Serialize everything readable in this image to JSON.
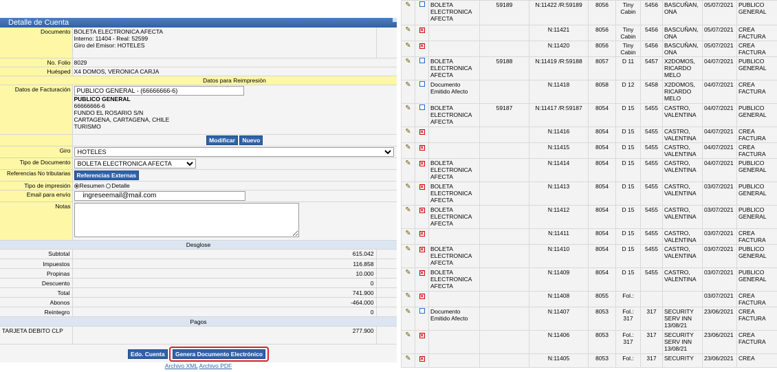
{
  "panel_title": "Detalle de Cuenta",
  "form": {
    "documento_label": "Documento",
    "documento_lines": [
      "BOLETA ELECTRONICA AFECTA",
      "Interno: 11404 - Real: 52599",
      "Giro del Emisor: HOTELES"
    ],
    "folio_label": "No. Folio",
    "folio_value": "8029",
    "huesped_label": "Huésped",
    "huesped_value": "X4 DOMOS, VERONICA CARJA",
    "reimpresion_header": "Datos para Reimpresión",
    "facturacion_label": "Datos de Facturación",
    "facturacion_input": "PUBLICO GENERAL - (66666666-6)",
    "facturacion_name": "PUBLICO GENERAL",
    "facturacion_lines": [
      "66666666-6",
      "FUNDO EL ROSARIO S/N",
      "CARTAGENA, CARTAGENA, CHILE",
      "TURISMO"
    ],
    "modificar_btn": "Modificar",
    "nuevo_btn": "Nuevo",
    "giro_label": "Giro",
    "giro_value": "HOTELES",
    "tipo_doc_label": "Tipo de Documento",
    "tipo_doc_value": "BOLETA ELECTRONICA AFECTA",
    "referencias_label": "Referencias No tributarias",
    "referencias_btn": "Referencias Externas",
    "tipo_impresion_label": "Tipo de impresión",
    "resumen_label": "Resumen",
    "detalle_label": "Detalle",
    "email_label": "Email para envío",
    "email_value": "ingreseemail@mail.com",
    "notas_label": "Notas"
  },
  "desglose": {
    "header": "Desglose",
    "rows": [
      {
        "label": "Subtotal",
        "value": "615.042"
      },
      {
        "label": "Impuestos",
        "value": "116.858"
      },
      {
        "label": "Propinas",
        "value": "10.000"
      },
      {
        "label": "Descuento",
        "value": "0"
      },
      {
        "label": "Total",
        "value": "741.900"
      },
      {
        "label": "Abonos",
        "value": "-464.000"
      },
      {
        "label": "Reintegro",
        "value": "0"
      }
    ]
  },
  "pagos": {
    "header": "Pagos",
    "method": "TARJETA DEBITO CLP",
    "amount": "277.900"
  },
  "actions": {
    "edo_cuenta": "Edo. Cuenta",
    "genera_doc": "Genera Documento Electrónico",
    "archivo_xml": "Archivo XML",
    "archivo_pdf": "Archivo PDF"
  },
  "grid_rows": [
    {
      "status": "square",
      "doc": "BOLETA ELECTRONICA AFECTA",
      "folio": "59189",
      "ref": "N:11422 /R:59189",
      "num": "8056",
      "hab": "Tiny Cabin",
      "code": "5456",
      "name": "BASCUÑAN, ONA",
      "date": "05/07/2021",
      "type": "PUBLICO GENERAL"
    },
    {
      "status": "x",
      "doc": "",
      "folio": "",
      "ref": "N:11421",
      "num": "8056",
      "hab": "Tiny Cabin",
      "code": "5456",
      "name": "BASCUÑAN, ONA",
      "date": "05/07/2021",
      "type": "CREA FACTURA"
    },
    {
      "status": "x",
      "doc": "",
      "folio": "",
      "ref": "N:11420",
      "num": "8056",
      "hab": "Tiny Cabin",
      "code": "5456",
      "name": "BASCUÑAN, ONA",
      "date": "05/07/2021",
      "type": "CREA FACTURA"
    },
    {
      "status": "square",
      "doc": "BOLETA ELECTRONICA AFECTA",
      "folio": "59188",
      "ref": "N:11419 /R:59188",
      "num": "8057",
      "hab": "D 11",
      "code": "5457",
      "name": "X2DOMOS, RICARDO MELO",
      "date": "04/07/2021",
      "type": "PUBLICO GENERAL"
    },
    {
      "status": "square",
      "doc": "Documento Emitido Afecto",
      "folio": "",
      "ref": "N:11418",
      "num": "8058",
      "hab": "D 12",
      "code": "5458",
      "name": "X2DOMOS, RICARDO MELO",
      "date": "04/07/2021",
      "type": "CREA FACTURA"
    },
    {
      "status": "square",
      "doc": "BOLETA ELECTRONICA AFECTA",
      "folio": "59187",
      "ref": "N:11417 /R:59187",
      "num": "8054",
      "hab": "D 15",
      "code": "5455",
      "name": "CASTRO, VALENTINA",
      "date": "04/07/2021",
      "type": "PUBLICO GENERAL"
    },
    {
      "status": "x",
      "doc": "",
      "folio": "",
      "ref": "N:11416",
      "num": "8054",
      "hab": "D 15",
      "code": "5455",
      "name": "CASTRO, VALENTINA",
      "date": "04/07/2021",
      "type": "CREA FACTURA"
    },
    {
      "status": "x",
      "doc": "",
      "folio": "",
      "ref": "N:11415",
      "num": "8054",
      "hab": "D 15",
      "code": "5455",
      "name": "CASTRO, VALENTINA",
      "date": "04/07/2021",
      "type": "CREA FACTURA"
    },
    {
      "status": "x",
      "doc": "BOLETA ELECTRONICA AFECTA",
      "folio": "",
      "ref": "N:11414",
      "num": "8054",
      "hab": "D 15",
      "code": "5455",
      "name": "CASTRO, VALENTINA",
      "date": "04/07/2021",
      "type": "PUBLICO GENERAL"
    },
    {
      "status": "x",
      "doc": "BOLETA ELECTRONICA AFECTA",
      "folio": "",
      "ref": "N:11413",
      "num": "8054",
      "hab": "D 15",
      "code": "5455",
      "name": "CASTRO, VALENTINA",
      "date": "03/07/2021",
      "type": "PUBLICO GENERAL"
    },
    {
      "status": "x",
      "doc": "BOLETA ELECTRONICA AFECTA",
      "folio": "",
      "ref": "N:11412",
      "num": "8054",
      "hab": "D 15",
      "code": "5455",
      "name": "CASTRO, VALENTINA",
      "date": "03/07/2021",
      "type": "PUBLICO GENERAL"
    },
    {
      "status": "x",
      "doc": "",
      "folio": "",
      "ref": "N:11411",
      "num": "8054",
      "hab": "D 15",
      "code": "5455",
      "name": "CASTRO, VALENTINA",
      "date": "03/07/2021",
      "type": "CREA FACTURA"
    },
    {
      "status": "x",
      "doc": "BOLETA ELECTRONICA AFECTA",
      "folio": "",
      "ref": "N:11410",
      "num": "8054",
      "hab": "D 15",
      "code": "5455",
      "name": "CASTRO, VALENTINA",
      "date": "03/07/2021",
      "type": "PUBLICO GENERAL"
    },
    {
      "status": "x",
      "doc": "BOLETA ELECTRONICA AFECTA",
      "folio": "",
      "ref": "N:11409",
      "num": "8054",
      "hab": "D 15",
      "code": "5455",
      "name": "CASTRO, VALENTINA",
      "date": "03/07/2021",
      "type": "PUBLICO GENERAL"
    },
    {
      "status": "x",
      "doc": "",
      "folio": "",
      "ref": "N:11408",
      "num": "8055",
      "hab": "Fol.:",
      "code": "",
      "name": "",
      "date": "03/07/2021",
      "type": "CREA FACTURA"
    },
    {
      "status": "square",
      "doc": "Documento Emitido Afecto",
      "folio": "",
      "ref": "N:11407",
      "num": "8053",
      "hab": "Fol.: 317",
      "code": "317",
      "name": "SECURITY SERV INN 13/08/21",
      "date": "23/06/2021",
      "type": "CREA FACTURA"
    },
    {
      "status": "x",
      "doc": "",
      "folio": "",
      "ref": "N:11406",
      "num": "8053",
      "hab": "Fol.: 317",
      "code": "317",
      "name": "SECURITY SERV INN 13/08/21",
      "date": "23/06/2021",
      "type": "CREA FACTURA"
    },
    {
      "status": "x",
      "doc": "",
      "folio": "",
      "ref": "N:11405",
      "num": "8053",
      "hab": "Fol.:",
      "code": "317",
      "name": "SECURITY",
      "date": "23/06/2021",
      "type": "CREA"
    }
  ]
}
